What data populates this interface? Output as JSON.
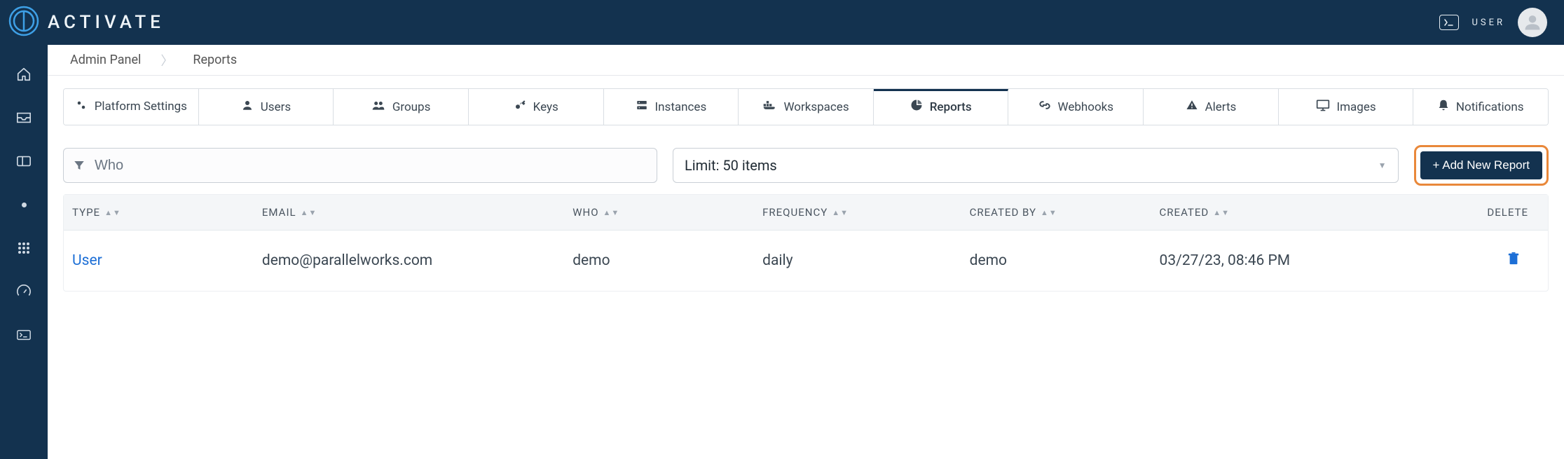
{
  "brand": {
    "name": "ACTIVATE"
  },
  "topbar": {
    "user_label": "USER"
  },
  "breadcrumb": {
    "root": "Admin Panel",
    "current": "Reports"
  },
  "tabs": {
    "platform_settings": "Platform Settings",
    "users": "Users",
    "groups": "Groups",
    "keys": "Keys",
    "instances": "Instances",
    "workspaces": "Workspaces",
    "reports": "Reports",
    "webhooks": "Webhooks",
    "alerts": "Alerts",
    "images": "Images",
    "notifications": "Notifications"
  },
  "toolbar": {
    "who_placeholder": "Who",
    "limit_label": "Limit: 50 items",
    "add_label": "+ Add New Report"
  },
  "table": {
    "headers": {
      "type": "TYPE",
      "email": "EMAIL",
      "who": "WHO",
      "frequency": "FREQUENCY",
      "created_by": "CREATED BY",
      "created": "CREATED",
      "delete": "DELETE"
    },
    "rows": [
      {
        "type": "User",
        "email": "demo@parallelworks.com",
        "who": "demo",
        "frequency": "daily",
        "created_by": "demo",
        "created": "03/27/23, 08:46 PM"
      }
    ]
  }
}
